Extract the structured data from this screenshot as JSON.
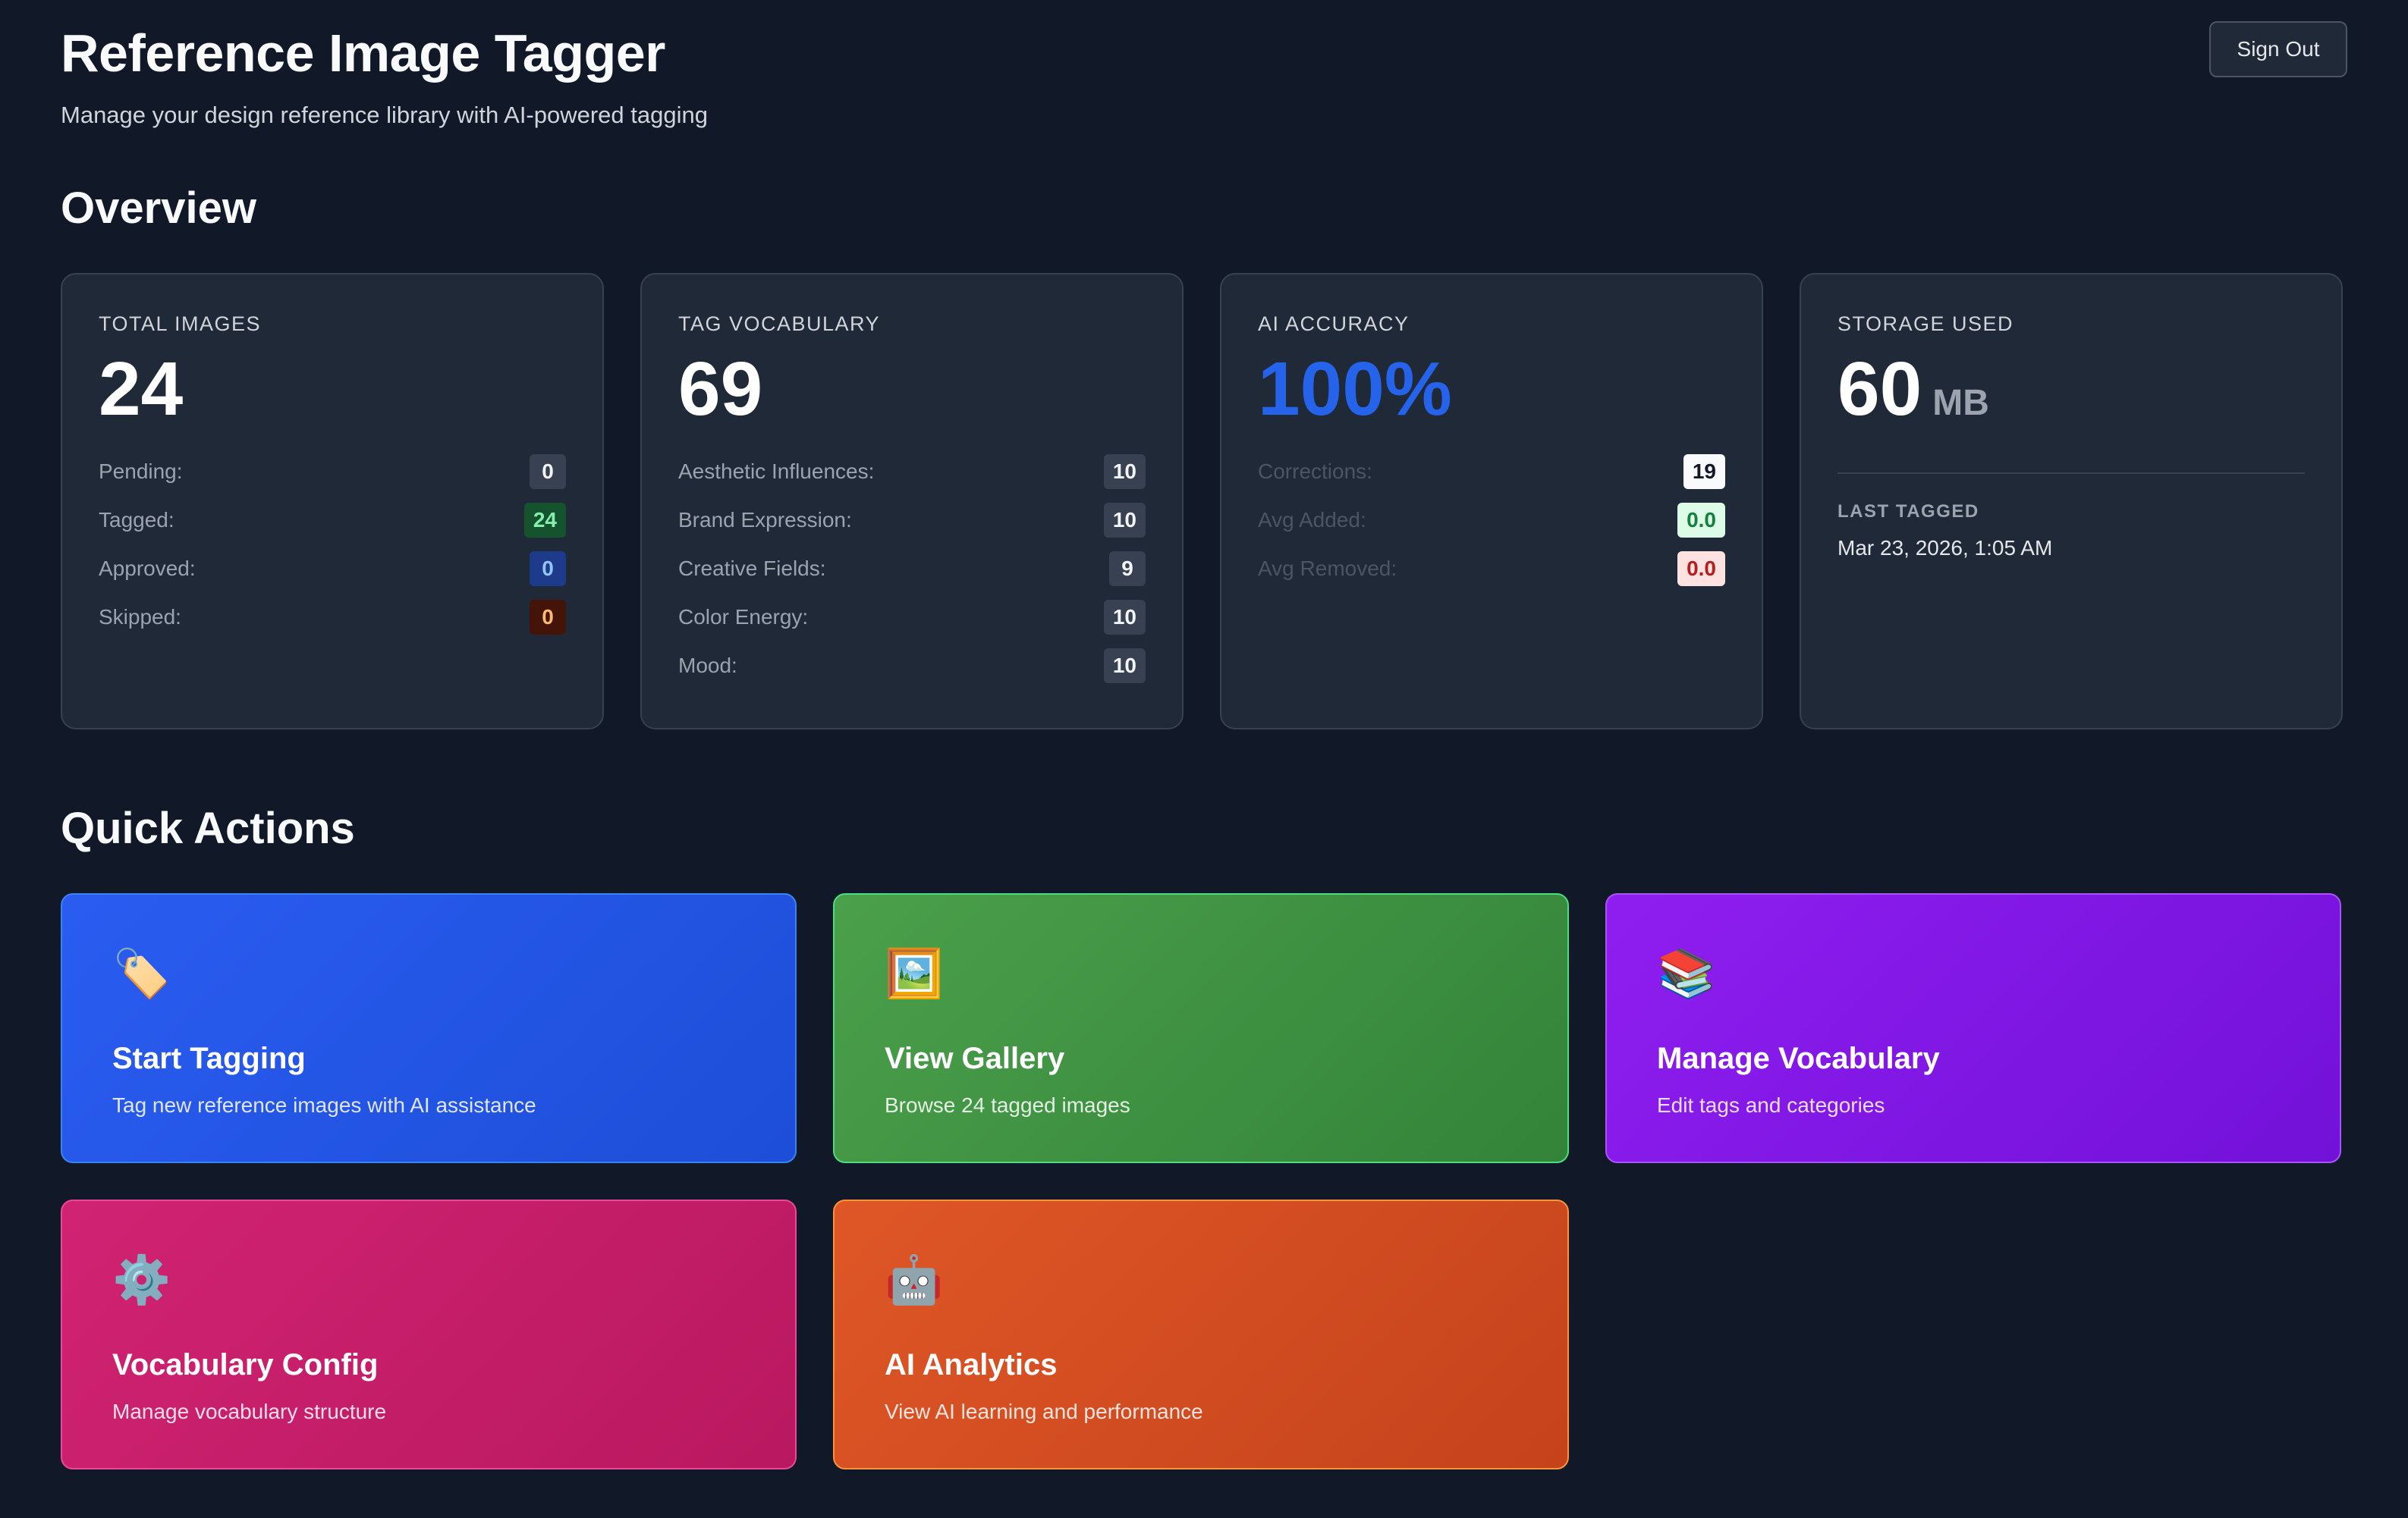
{
  "header": {
    "title": "Reference Image Tagger",
    "subtitle": "Manage your design reference library with AI-powered tagging",
    "sign_out_label": "Sign Out"
  },
  "overview": {
    "title": "Overview",
    "total_images": {
      "label": "TOTAL IMAGES",
      "value": "24",
      "rows": [
        {
          "label": "Pending:",
          "value": "0"
        },
        {
          "label": "Tagged:",
          "value": "24"
        },
        {
          "label": "Approved:",
          "value": "0"
        },
        {
          "label": "Skipped:",
          "value": "0"
        }
      ]
    },
    "tag_vocabulary": {
      "label": "TAG VOCABULARY",
      "value": "69",
      "rows": [
        {
          "label": "Aesthetic Influences:",
          "value": "10"
        },
        {
          "label": "Brand Expression:",
          "value": "10"
        },
        {
          "label": "Creative Fields:",
          "value": "9"
        },
        {
          "label": "Color Energy:",
          "value": "10"
        },
        {
          "label": "Mood:",
          "value": "10"
        }
      ]
    },
    "ai_accuracy": {
      "label": "AI ACCURACY",
      "value": "100%",
      "rows": [
        {
          "label": "Corrections:",
          "value": "19"
        },
        {
          "label": "Avg Added:",
          "value": "0.0"
        },
        {
          "label": "Avg Removed:",
          "value": "0.0"
        }
      ]
    },
    "storage": {
      "label": "STORAGE USED",
      "value": "60",
      "unit": "MB",
      "last_tagged_label": "LAST TAGGED",
      "last_tagged_value": "Mar 23, 2026, 1:05 AM"
    }
  },
  "quick_actions": {
    "title": "Quick Actions",
    "items": [
      {
        "icon": "🏷️",
        "icon_name": "tag-icon",
        "title": "Start Tagging",
        "description": "Tag new reference images with AI assistance",
        "color": "#2a5cf1"
      },
      {
        "icon": "🖼️",
        "icon_name": "framed-picture-icon",
        "title": "View Gallery",
        "description": "Browse 24 tagged images",
        "color": "#4ba04b"
      },
      {
        "icon": "📚",
        "icon_name": "books-icon",
        "title": "Manage Vocabulary",
        "description": "Edit tags and categories",
        "color": "#8f1ef0"
      },
      {
        "icon": "⚙️",
        "icon_name": "gear-icon",
        "title": "Vocabulary Config",
        "description": "Manage vocabulary structure",
        "color": "#d12373"
      },
      {
        "icon": "🤖",
        "icon_name": "robot-icon",
        "title": "AI Analytics",
        "description": "View AI learning and performance",
        "color": "#df5727"
      }
    ]
  },
  "colors": {
    "background": "#111827",
    "card": "#1f2937",
    "accent_blue": "#2563eb"
  }
}
